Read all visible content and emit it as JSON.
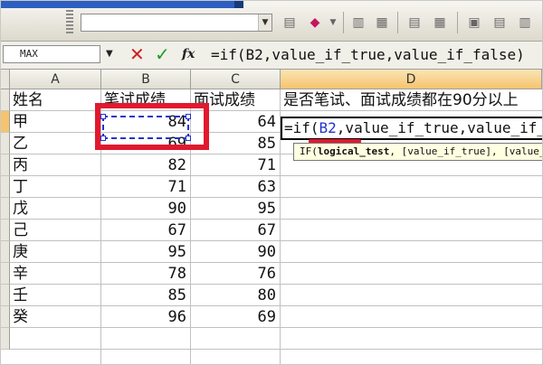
{
  "toolbar": {
    "font_combo_value": "",
    "icons": [
      "paste-icon",
      "fill-color-icon",
      "align-left-icon",
      "align-center-icon",
      "align-right-icon",
      "merge-icon"
    ]
  },
  "formula_bar": {
    "name_box": "MAX",
    "cancel_symbol": "✕",
    "enter_symbol": "✓",
    "insert_function_symbol": "fx",
    "formula": "=if(B2,value_if_true,value_if_false)"
  },
  "columns": [
    "A",
    "B",
    "C",
    "D"
  ],
  "header_row": {
    "a": "姓名",
    "b": "笔试成绩",
    "c": "面试成绩",
    "d": "是否笔试、面试成绩都在90分以上"
  },
  "rows": [
    {
      "name": "甲",
      "written": "84",
      "interview": "64"
    },
    {
      "name": "乙",
      "written": "69",
      "interview": "85"
    },
    {
      "name": "丙",
      "written": "82",
      "interview": "71"
    },
    {
      "name": "丁",
      "written": "71",
      "interview": "63"
    },
    {
      "name": "戊",
      "written": "90",
      "interview": "95"
    },
    {
      "name": "己",
      "written": "67",
      "interview": "67"
    },
    {
      "name": "庚",
      "written": "95",
      "interview": "90"
    },
    {
      "name": "辛",
      "written": "78",
      "interview": "76"
    },
    {
      "name": "壬",
      "written": "85",
      "interview": "80"
    },
    {
      "name": "癸",
      "written": "96",
      "interview": "69"
    }
  ],
  "edit_cell": {
    "prefix": "=if(",
    "reference": "B2",
    "suffix": ",value_if_true,value_if_false)"
  },
  "tooltip": {
    "fn": "IF(",
    "arg1": "logical_test",
    "rest": ", [value_if_true], [value_if_false])"
  },
  "colors": {
    "highlight_red": "#e1192f",
    "reference_blue": "#2233cc",
    "active_header": "#f5c46d"
  }
}
